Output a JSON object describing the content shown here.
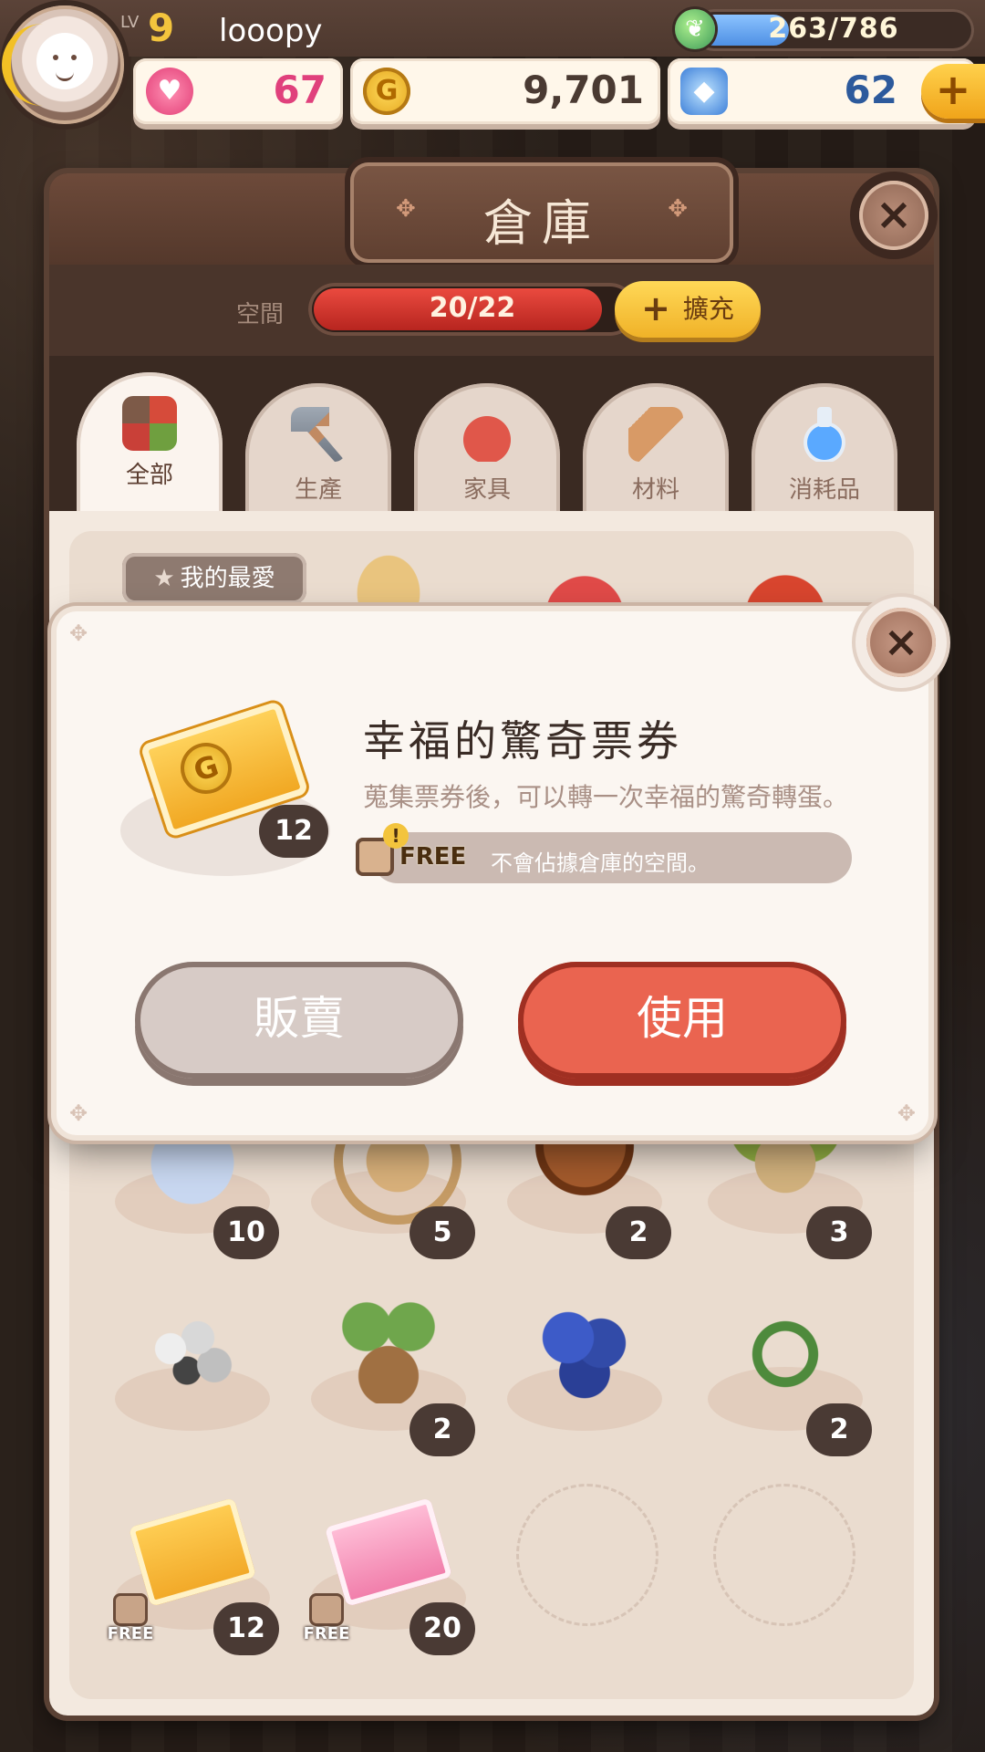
{
  "player": {
    "level_label": "LV",
    "level": "9",
    "name": "looopy"
  },
  "energy": {
    "text": "263/786",
    "current": 263,
    "max": 786
  },
  "resources": {
    "hearts": "67",
    "gold": "9,701",
    "gems": "62",
    "add_label": "+"
  },
  "storage": {
    "title": "倉庫",
    "space_label": "空間",
    "space_text": "20/22",
    "space_used": 20,
    "space_max": 22,
    "expand_label": "擴充",
    "close_label": "×",
    "tabs": [
      {
        "label": "全部",
        "icon": "grid-icon",
        "active": true
      },
      {
        "label": "生產",
        "icon": "hammer-icon"
      },
      {
        "label": "家具",
        "icon": "sofa-icon"
      },
      {
        "label": "材料",
        "icon": "log-icon"
      },
      {
        "label": "消耗品",
        "icon": "potion-icon"
      }
    ],
    "favorite_label": "我的最愛",
    "items_row1": [
      {
        "icon": "rice-icon"
      },
      {
        "icon": "wheat-icon"
      },
      {
        "icon": "strawberry-icon"
      },
      {
        "icon": "tomato-icon"
      }
    ],
    "items_row3": [
      {
        "icon": "salt-icon",
        "qty": "10"
      },
      {
        "icon": "straw-rope-icon",
        "qty": "5"
      },
      {
        "icon": "bread-icon",
        "qty": "2"
      },
      {
        "icon": "onion-icon",
        "qty": "3"
      }
    ],
    "items_row4": [
      {
        "icon": "stones-icon",
        "qty": ""
      },
      {
        "icon": "sapling-icon",
        "qty": "2"
      },
      {
        "icon": "blueberry-icon",
        "qty": ""
      },
      {
        "icon": "vine-icon",
        "qty": "2"
      }
    ],
    "items_row5": [
      {
        "icon": "gold-ticket-icon",
        "qty": "12",
        "free": "FREE"
      },
      {
        "icon": "heart-ticket-icon",
        "qty": "20",
        "free": "FREE"
      }
    ]
  },
  "dialog": {
    "title": "幸福的驚奇票券",
    "description": "蒐集票券後，可以轉一次幸福的驚奇轉蛋。",
    "quantity": "12",
    "free_tag": "FREE",
    "free_note": "不會佔據倉庫的空間。",
    "sell_label": "販賣",
    "use_label": "使用",
    "close_label": "×",
    "coin_letter": "G"
  },
  "colors": {
    "accent_red": "#ea6450",
    "gold": "#f3c43d",
    "energy_blue": "#4e90e4"
  }
}
